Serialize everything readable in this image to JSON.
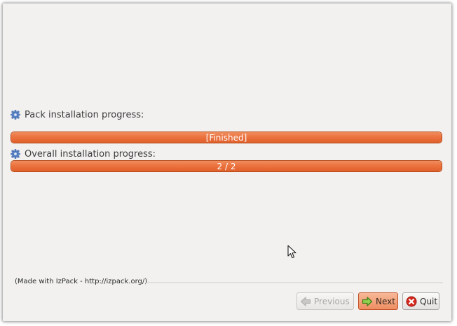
{
  "progress": {
    "pack": {
      "label": "Pack installation progress:",
      "status_text": "[Finished]",
      "fraction": 1.0
    },
    "overall": {
      "label": "Overall installation progress:",
      "status_text": "2 / 2",
      "fraction": 1.0
    },
    "icon": "gear-icon",
    "accent_color": "#ec7340"
  },
  "footer": {
    "credit": "(Made with IzPack - http://izpack.org/)"
  },
  "buttons": {
    "previous": {
      "label": "Previous",
      "icon": "arrow-left-icon",
      "enabled": false
    },
    "next": {
      "label": "Next",
      "icon": "arrow-right-icon",
      "enabled": true
    },
    "quit": {
      "label": "Quit",
      "icon": "close-icon",
      "enabled": true
    }
  }
}
